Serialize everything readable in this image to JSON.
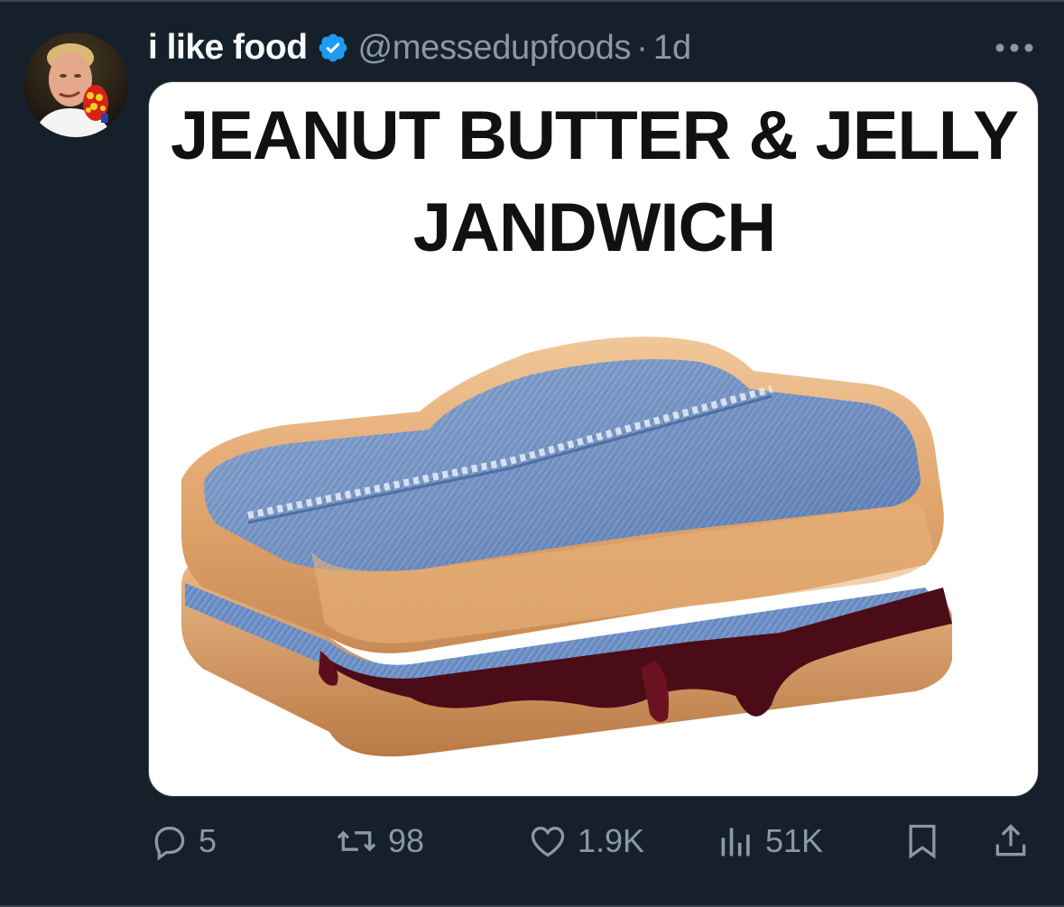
{
  "post": {
    "display_name": "i like food",
    "handle": "@messedupfoods",
    "separator": "·",
    "time": "1d"
  },
  "image_caption": {
    "line1": "JEANUT BUTTER & JELLY",
    "line2": "JANDWICH"
  },
  "actions": {
    "replies": "5",
    "reposts": "98",
    "likes": "1.9K",
    "views": "51K"
  },
  "colors": {
    "background": "#15202b",
    "text_primary": "#f7f9f9",
    "text_secondary": "#8b98a5",
    "verified_blue": "#1d9bf0"
  },
  "icons": [
    "verified-badge-icon",
    "more-icon",
    "reply-icon",
    "repost-icon",
    "like-icon",
    "views-icon",
    "bookmark-icon",
    "share-icon"
  ]
}
